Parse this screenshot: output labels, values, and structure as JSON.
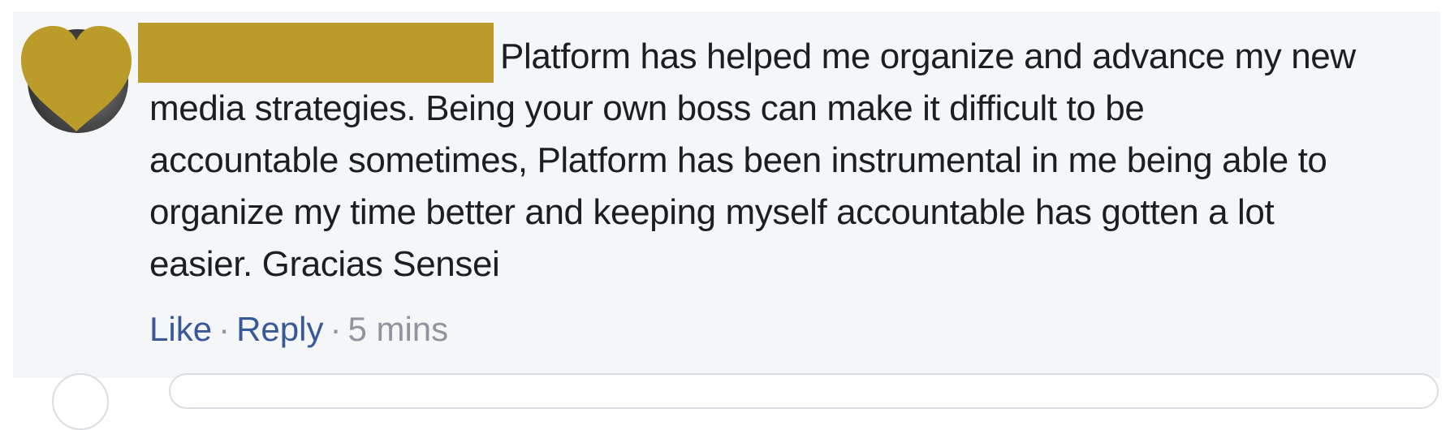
{
  "comment": {
    "lines": [
      "Platform has helped me organize and advance my new",
      "media strategies. Being your own boss can make it difficult to be",
      "accountable sometimes, Platform has been instrumental in me being able to",
      "organize my time better and keeping myself accountable has gotten a lot",
      "easier. Gracias Sensei"
    ],
    "actions": {
      "like": "Like",
      "separator": "·",
      "reply": "Reply",
      "time": "5 mins"
    }
  },
  "colors": {
    "card_background": "#f5f6f8",
    "redaction": "#bb9b29",
    "link": "#385898",
    "meta": "#90949c",
    "text": "#1c1e21"
  },
  "icons": {
    "avatar_overlay": "heart-icon"
  }
}
